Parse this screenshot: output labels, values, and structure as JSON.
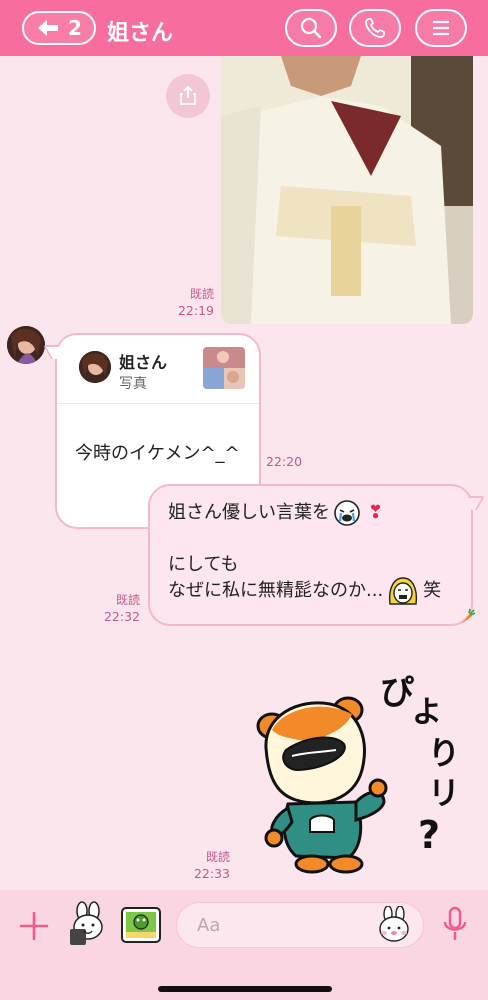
{
  "header": {
    "back_count": "2",
    "title": "姐さん"
  },
  "messages": {
    "photo_read": "既読",
    "photo_time": "22:19",
    "reply": {
      "quote_name": "姐さん",
      "quote_type": "写真",
      "text": "今時のイケメン^_^",
      "time": "22:20"
    },
    "sent": {
      "line1": "姐さん優しい言葉を",
      "line2": "にしても",
      "line3": "なぜに私に無精髭なのか...",
      "line3_suffix": "笑",
      "read": "既読",
      "time": "22:32"
    },
    "sticker_read": "既読",
    "sticker_time": "22:33",
    "sticker_text": "ぴよりりリ？"
  },
  "input": {
    "placeholder": "Aa"
  },
  "colors": {
    "header": "#f76d9d",
    "background": "#fbe6ee",
    "bubble_border": "#f2b8cf",
    "meta_text": "#c2588b"
  }
}
